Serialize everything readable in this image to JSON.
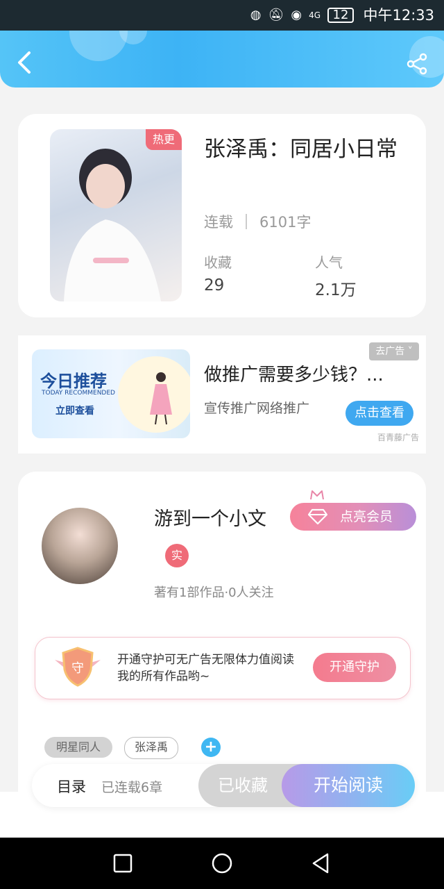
{
  "status_bar": {
    "signal_text": "4G",
    "battery": "12",
    "time": "中午12:33"
  },
  "book": {
    "hot_badge": "热更",
    "title": "张泽禹：同居小日常",
    "status": "连载",
    "word_count": "6101字",
    "favorites_label": "收藏",
    "favorites_value": "29",
    "popularity_label": "人气",
    "popularity_value": "2.1万"
  },
  "ad": {
    "banner_title": "今日推荐",
    "banner_subtitle": "TODAY RECOMMENDED",
    "banner_button": "立即查看",
    "remove_label": "去广告 ˅",
    "title": "做推广需要多少钱？...",
    "subtitle": "宣传推广网络推广",
    "cta": "点击查看",
    "source": "百青藤广告"
  },
  "author": {
    "name": "游到一个小文",
    "vip_label": "点亮会员",
    "real_badge": "实",
    "meta": "著有1部作品·0人关注"
  },
  "guard": {
    "shield_char": "守",
    "text": "开通守护可无广告无限体力值阅读我的所有作品哟~",
    "button": "开通守护"
  },
  "tags": [
    "明星同人",
    "张泽禹"
  ],
  "tag_add": "+",
  "action_bar": {
    "toc_label": "目录",
    "chapters": "已连载6章",
    "collected": "已收藏",
    "read": "开始阅读"
  },
  "colors": {
    "header_blue": "#3db3f5",
    "hot_red": "#ef6b78",
    "ad_blue": "#3fa8f0"
  }
}
